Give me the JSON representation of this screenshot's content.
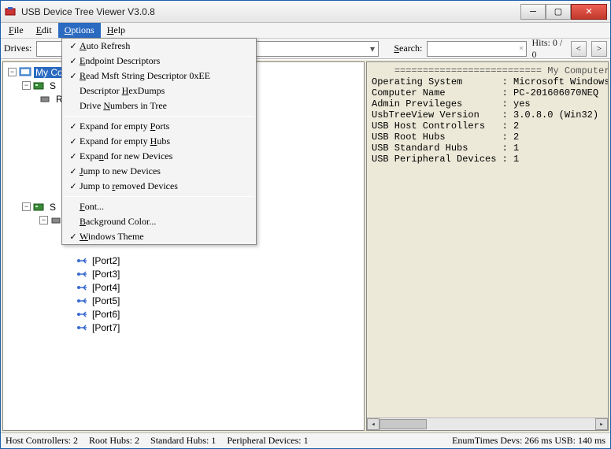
{
  "window": {
    "title": "USB Device Tree Viewer V3.0.8"
  },
  "menubar": {
    "file": "File",
    "file_u": "F",
    "edit": "Edit",
    "edit_u": "E",
    "options": "Options",
    "options_u": "O",
    "help": "Help",
    "help_u": "H"
  },
  "toolbar": {
    "drives_label": "Drives:",
    "search_label": "Search:",
    "search_u": "S",
    "hits": "Hits: 0 / 0"
  },
  "options_menu": {
    "items": [
      {
        "label": "Auto Refresh",
        "u": "A",
        "checked": true
      },
      {
        "label": "Endpoint Descriptors",
        "u": "E",
        "checked": true
      },
      {
        "label": "Read Msft String Descriptor 0xEE",
        "u": "R",
        "checked": true
      },
      {
        "label": "Descriptor HexDumps",
        "u": "H",
        "checked": false
      },
      {
        "label": "Drive Numbers in Tree",
        "u": "N",
        "checked": false
      },
      {
        "sep": true
      },
      {
        "label": "Expand for empty Ports",
        "u": "P",
        "checked": true
      },
      {
        "label": "Expand for empty Hubs",
        "u": "H",
        "checked": true
      },
      {
        "label": "Expand for new Devices",
        "u": "n",
        "checked": true
      },
      {
        "label": "Jump to new Devices",
        "u": "J",
        "checked": true
      },
      {
        "label": "Jump to removed Devices",
        "u": "r",
        "checked": true
      },
      {
        "sep": true
      },
      {
        "label": "Font...",
        "u": "F",
        "checked": false
      },
      {
        "label": "Background Color...",
        "u": "B",
        "checked": false
      },
      {
        "label": "Windows Theme",
        "u": "W",
        "checked": true
      }
    ]
  },
  "tree": {
    "root": "My Co",
    "node_s1": "S",
    "node_roo": "ROO",
    "node_s2": "S",
    "node_r": "R",
    "ports": [
      "[Port2]",
      "[Port3]",
      "[Port4]",
      "[Port5]",
      "[Port6]",
      "[Port7]"
    ]
  },
  "details": {
    "header": "========================== My Computer",
    "lines": [
      "Operating System       : Microsoft Windows",
      "Computer Name          : PC-201606070NEQ",
      "Admin Previleges       : yes",
      "",
      "UsbTreeView Version    : 3.0.8.0 (Win32)",
      "",
      "USB Host Controllers   : 2",
      "USB Root Hubs          : 2",
      "USB Standard Hubs      : 1",
      "USB Peripheral Devices : 1"
    ]
  },
  "status": {
    "host": "Host Controllers: 2",
    "root": "Root Hubs: 2",
    "std": "Standard Hubs: 1",
    "periph": "Peripheral Devices: 1",
    "enum": "EnumTimes   Devs: 266 ms   USB: 140 ms"
  }
}
